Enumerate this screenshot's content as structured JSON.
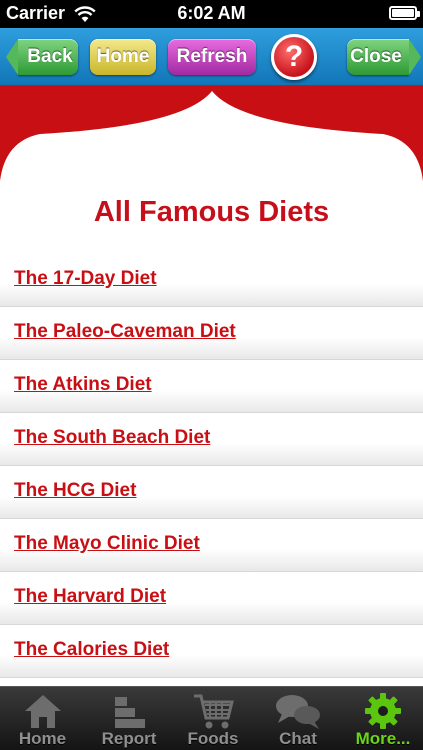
{
  "status_bar": {
    "carrier": "Carrier",
    "time": "6:02 AM"
  },
  "toolbar": {
    "back_label": "Back",
    "home_label": "Home",
    "refresh_label": "Refresh",
    "help_label": "?",
    "close_label": "Close"
  },
  "page": {
    "title": "All Famous Diets"
  },
  "diets": [
    {
      "label": "The 17-Day Diet"
    },
    {
      "label": "The Paleo-Caveman Diet"
    },
    {
      "label": "The Atkins Diet"
    },
    {
      "label": "The South Beach Diet"
    },
    {
      "label": "The HCG Diet"
    },
    {
      "label": "The Mayo Clinic Diet"
    },
    {
      "label": "The Harvard Diet"
    },
    {
      "label": "The Calories Diet"
    }
  ],
  "tabbar": {
    "tabs": [
      {
        "label": "Home",
        "icon": "house-icon"
      },
      {
        "label": "Report",
        "icon": "report-icon"
      },
      {
        "label": "Foods",
        "icon": "cart-icon"
      },
      {
        "label": "Chat",
        "icon": "chat-bubbles-icon"
      },
      {
        "label": "More...",
        "icon": "gear-icon",
        "active": true
      }
    ]
  },
  "colors": {
    "brand_red": "#c80f14",
    "toolbar_blue": "#1e87cc",
    "active_green": "#6bd615"
  }
}
